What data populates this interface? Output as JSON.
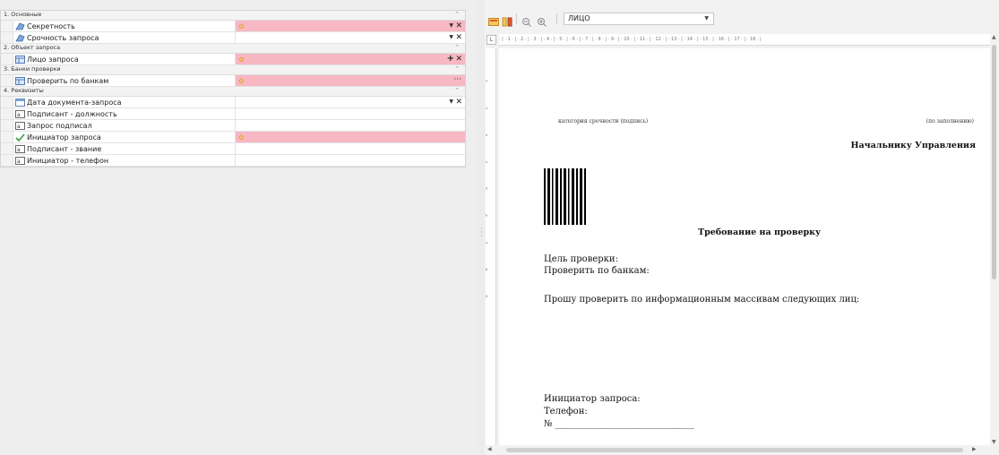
{
  "properties": {
    "sections": [
      {
        "title": "1. Основные",
        "rows": [
          {
            "label": "Секретность",
            "required": true,
            "star": true,
            "dropdown": true,
            "clear": true,
            "icon": "stamp-icon"
          },
          {
            "label": "Срочность запроса",
            "required": false,
            "star": false,
            "dropdown": true,
            "clear": true,
            "icon": "stamp-icon"
          }
        ]
      },
      {
        "title": "2. Объект запроса",
        "rows": [
          {
            "label": "Лицо запроса",
            "required": true,
            "star": true,
            "plus": true,
            "clear": true,
            "icon": "table-icon"
          }
        ]
      },
      {
        "title": "3. Банки проверки",
        "rows": [
          {
            "label": "Проверить по банкам",
            "required": true,
            "star": true,
            "ellipsis": true,
            "icon": "table-icon"
          }
        ]
      },
      {
        "title": "4. Реквизиты",
        "rows": [
          {
            "label": "Дата документа-запроса",
            "required": false,
            "dropdown": true,
            "clear": true,
            "icon": "calendar-icon"
          },
          {
            "label": "Подписант - должность",
            "required": false,
            "icon": "text-field-icon"
          },
          {
            "label": "Запрос подписал",
            "required": false,
            "icon": "text-field-icon"
          },
          {
            "label": "Инициатор запроса",
            "required": true,
            "star": true,
            "icon": "checkmark-icon"
          },
          {
            "label": "Подписант - звание",
            "required": false,
            "icon": "text-field-icon"
          },
          {
            "label": "Инициатор - телефон",
            "required": false,
            "icon": "text-field-icon"
          }
        ]
      }
    ]
  },
  "viewer": {
    "combo_value": "ЛИЦО",
    "ruler_text": "· | · 1 · | · 2 · | · 3 · | · 4 · | · 5 · | · 6 · | · 7 · | · 8 · | · 9 · | · 10 · | · 11 · | · 12 · | · 13 · | · 14 · | · 15 · | · 16 · | · 17 · | · 18 · |"
  },
  "document": {
    "urgency_label": "категория срочности (подпись)",
    "fill_note": "(по заполнению)",
    "addressee": "Начальнику Управления",
    "title": "Требование на проверку",
    "purpose": "Цель проверки:",
    "check_banks": "Проверить по банкам:",
    "request_text": "Прошу проверить по информационным массивам следующих лиц:",
    "initiator": "Инициатор запроса:",
    "phone": "Телефон:",
    "number": "№ _______________________________"
  }
}
